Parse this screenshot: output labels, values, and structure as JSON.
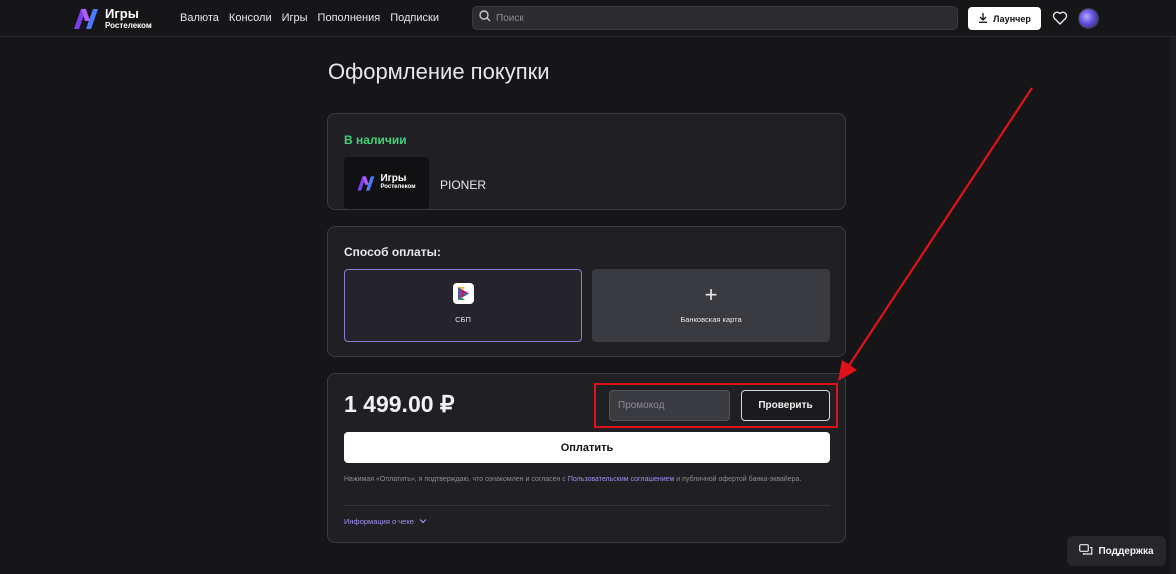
{
  "header": {
    "logo_line1": "Игры",
    "logo_line2": "Ростелеком",
    "nav": [
      "Валюта",
      "Консоли",
      "Игры",
      "Пополнения",
      "Подписки"
    ],
    "search_placeholder": "Поиск",
    "launcher_label": "Лаунчер",
    "icons": [
      "search-icon",
      "download-icon",
      "heart-icon",
      "avatar"
    ]
  },
  "page": {
    "title": "Оформление покупки"
  },
  "product": {
    "availability": "В наличии",
    "thumb_line1": "Игры",
    "thumb_line2": "Ростелеком",
    "name": "PIONER"
  },
  "payment": {
    "title": "Способ оплаты:",
    "options": [
      {
        "label": "СБП",
        "selected": true,
        "icon": "sbp-logo-icon"
      },
      {
        "label": "Банковская карта",
        "selected": false,
        "icon": "plus-icon"
      }
    ]
  },
  "checkout": {
    "price": "1 499.00 ₽",
    "promo_placeholder": "Промокод",
    "check_label": "Проверить",
    "pay_label": "Оплатить",
    "legal_prefix": "Нажимая «Оплатить», я подтверждаю, что ознакомлен и согласен с ",
    "legal_link": "Пользовательским соглашением",
    "legal_suffix": " и публичной офертой банка-эквайера.",
    "receipt_label": "Информация о чеке"
  },
  "support": {
    "label": "Поддержка"
  },
  "colors": {
    "background": "#161618",
    "card": "#202024",
    "accent_green": "#3fd07a",
    "accent_purple": "#a290f0",
    "annotation_red": "#e0131a"
  }
}
